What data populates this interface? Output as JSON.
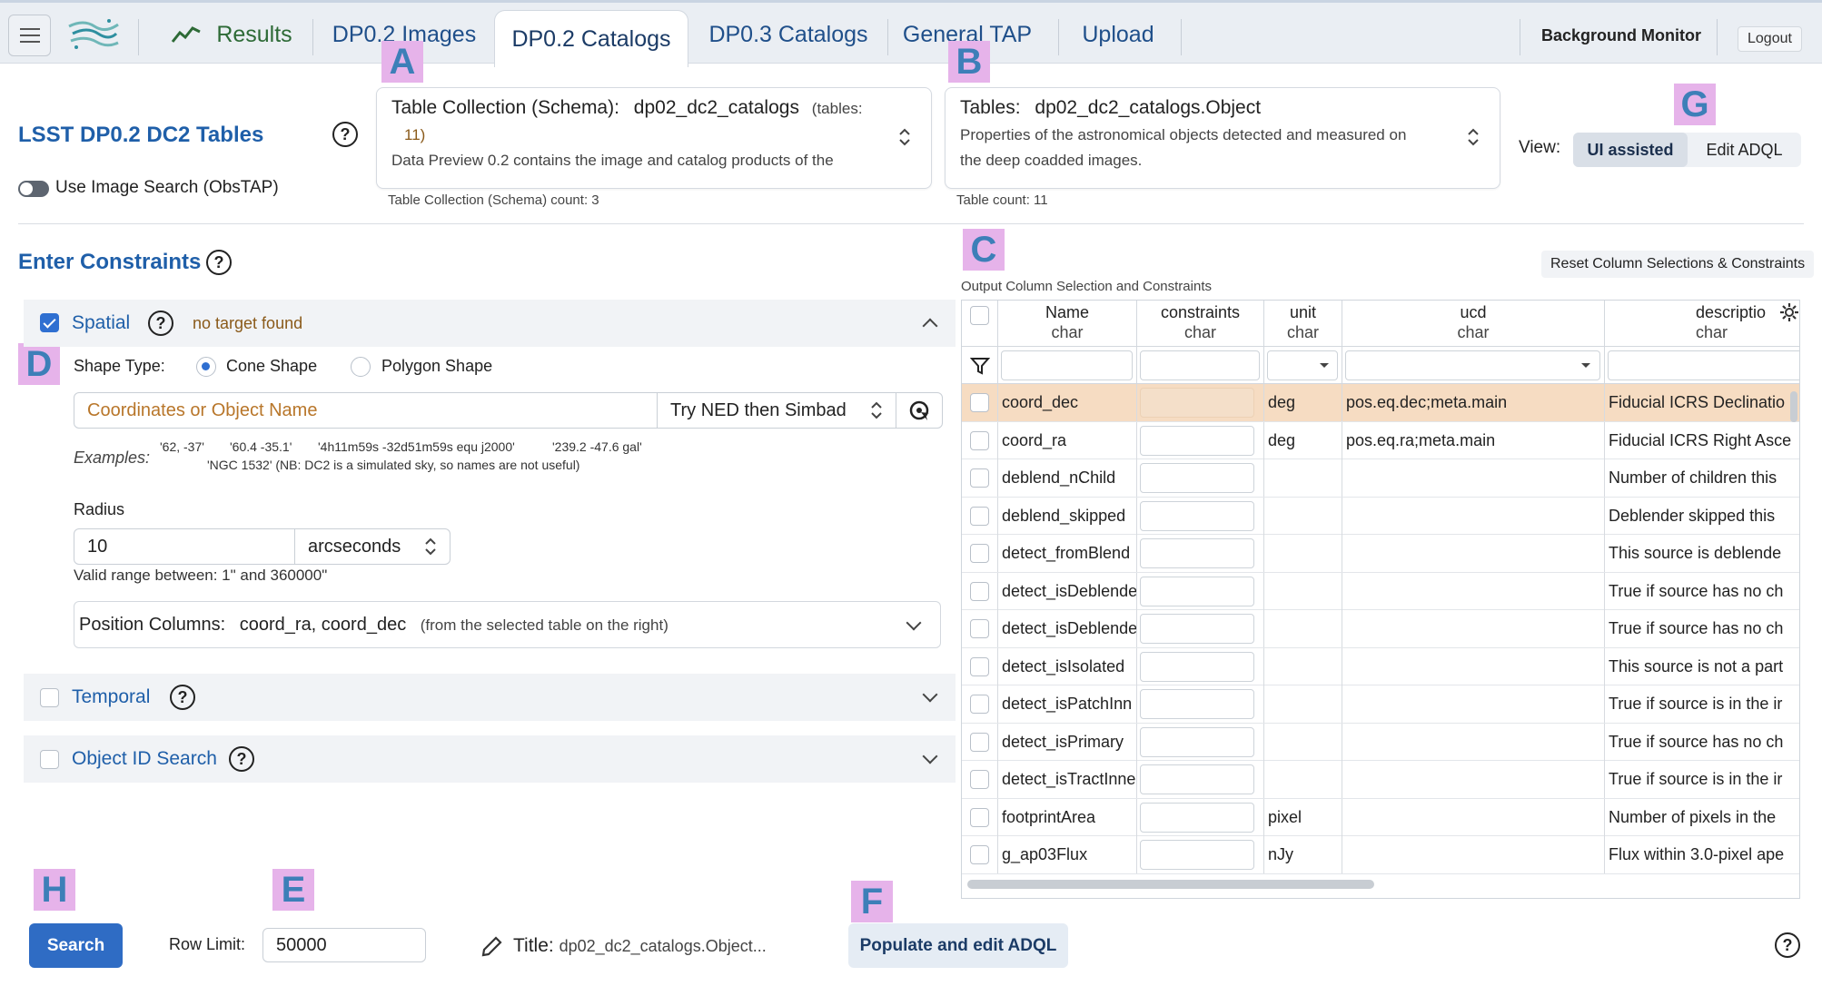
{
  "header": {
    "tabs": [
      {
        "label": "Results"
      },
      {
        "label": "DP0.2 Images"
      },
      {
        "label": "DP0.2 Catalogs"
      },
      {
        "label": "DP0.3 Catalogs"
      },
      {
        "label": "General TAP"
      },
      {
        "label": "Upload"
      }
    ],
    "active_tab": "DP0.2 Catalogs",
    "background_monitor": "Background Monitor",
    "logout": "Logout"
  },
  "markers": [
    "A",
    "B",
    "C",
    "D",
    "E",
    "F",
    "G",
    "H"
  ],
  "left": {
    "title": "LSST DP0.2 DC2 Tables",
    "obstap_toggle": "Use Image Search (ObsTAP)",
    "enter_constraints": "Enter Constraints",
    "spatial": {
      "label": "Spatial",
      "checked": true,
      "status": "no target found",
      "shape_type_label": "Shape Type:",
      "shape_options": [
        "Cone Shape",
        "Polygon Shape"
      ],
      "selected_shape": "Cone Shape",
      "coords_placeholder": "Coordinates or Object Name",
      "resolver": "Try NED then Simbad",
      "examples_label": "Examples:",
      "examples_line1": [
        "'62, -37'",
        "'60.4 -35.1'",
        "'4h11m59s -32d51m59s equ j2000'",
        "'239.2 -47.6 gal'"
      ],
      "examples_line2": "'NGC 1532' (NB: DC2 is a simulated sky, so names are not useful)",
      "radius_label": "Radius",
      "radius_value": "10",
      "radius_units": "arcseconds",
      "valid_range": "Valid range between: 1\" and 360000\"",
      "position_columns_label": "Position Columns:",
      "position_columns_value": "coord_ra, coord_dec",
      "position_columns_note": "(from the selected table on the right)"
    },
    "temporal": {
      "label": "Temporal",
      "checked": false
    },
    "object_id": {
      "label": "Object ID Search",
      "checked": false
    }
  },
  "schema": {
    "label": "Table Collection (Schema):",
    "value": "dp02_dc2_catalogs",
    "tables_note_1": "(tables:",
    "tables_note_2": "11)",
    "description": "Data Preview 0.2 contains the image and catalog products of the",
    "count": "Table Collection (Schema) count: 3"
  },
  "tables": {
    "label": "Tables:",
    "value": "dp02_dc2_catalogs.Object",
    "description_1": "Properties of the astronomical objects detected and measured on",
    "description_2": "the deep coadded images.",
    "count": "Table count: 11"
  },
  "view": {
    "label": "View:",
    "options": [
      "UI assisted",
      "Edit ADQL"
    ],
    "selected": "UI assisted"
  },
  "columns_panel": {
    "reset_button": "Reset Column Selections & Constraints",
    "title": "Output Column Selection and Constraints",
    "headers": [
      {
        "name": "Name",
        "type": "char"
      },
      {
        "name": "constraints",
        "type": "char"
      },
      {
        "name": "unit",
        "type": "char"
      },
      {
        "name": "ucd",
        "type": "char"
      },
      {
        "name": "descriptio",
        "type": "char"
      }
    ],
    "rows": [
      {
        "name": "coord_dec",
        "unit": "deg",
        "ucd": "pos.eq.dec;meta.main",
        "desc": "Fiducial ICRS Declinatio",
        "selected": true
      },
      {
        "name": "coord_ra",
        "unit": "deg",
        "ucd": "pos.eq.ra;meta.main",
        "desc": "Fiducial ICRS Right Asce",
        "selected": false
      },
      {
        "name": "deblend_nChild",
        "unit": "",
        "ucd": "",
        "desc": "Number of children this",
        "selected": false
      },
      {
        "name": "deblend_skipped",
        "unit": "",
        "ucd": "",
        "desc": "Deblender skipped this",
        "selected": false
      },
      {
        "name": "detect_fromBlend",
        "unit": "",
        "ucd": "",
        "desc": "This source is deblende",
        "selected": false
      },
      {
        "name": "detect_isDeblende",
        "unit": "",
        "ucd": "",
        "desc": "True if source has no ch",
        "selected": false
      },
      {
        "name": "detect_isDeblende",
        "unit": "",
        "ucd": "",
        "desc": "True if source has no ch",
        "selected": false
      },
      {
        "name": "detect_isIsolated",
        "unit": "",
        "ucd": "",
        "desc": "This source is not a part",
        "selected": false
      },
      {
        "name": "detect_isPatchInn",
        "unit": "",
        "ucd": "",
        "desc": "True if source is in the ir",
        "selected": false
      },
      {
        "name": "detect_isPrimary",
        "unit": "",
        "ucd": "",
        "desc": "True if source has no ch",
        "selected": false
      },
      {
        "name": "detect_isTractInne",
        "unit": "",
        "ucd": "",
        "desc": "True if source is in the ir",
        "selected": false
      },
      {
        "name": "footprintArea",
        "unit": "pixel",
        "ucd": "",
        "desc": "Number of pixels in the",
        "selected": false
      },
      {
        "name": "g_ap03Flux",
        "unit": "nJy",
        "ucd": "",
        "desc": "Flux within 3.0-pixel ape",
        "selected": false
      }
    ]
  },
  "footer": {
    "search_button": "Search",
    "row_limit_label": "Row Limit:",
    "row_limit_value": "50000",
    "title_label": "Title:",
    "title_value": "dp02_dc2_catalogs.Object...",
    "populate_button": "Populate and edit ADQL"
  },
  "colors": {
    "accent_blue": "#2f6cc4",
    "link_blue": "#1f5fa9",
    "selected_row": "#f6dcc2",
    "marker_bg": "#e6b3ea",
    "marker_fg": "#3d7fb8",
    "status_brown": "#8a5a1a"
  }
}
